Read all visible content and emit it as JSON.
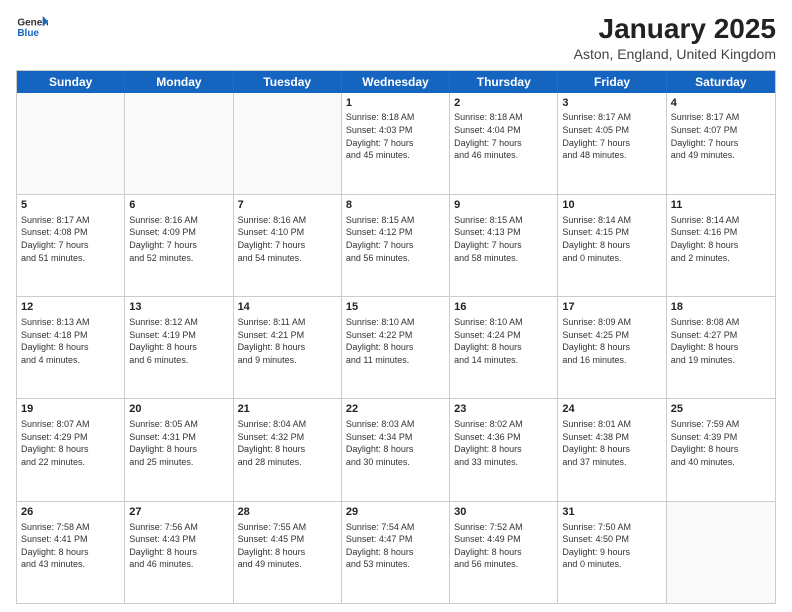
{
  "header": {
    "logo_general": "General",
    "logo_blue": "Blue",
    "title": "January 2025",
    "subtitle": "Aston, England, United Kingdom"
  },
  "weekdays": [
    "Sunday",
    "Monday",
    "Tuesday",
    "Wednesday",
    "Thursday",
    "Friday",
    "Saturday"
  ],
  "rows": [
    [
      {
        "day": "",
        "info": ""
      },
      {
        "day": "",
        "info": ""
      },
      {
        "day": "",
        "info": ""
      },
      {
        "day": "1",
        "info": "Sunrise: 8:18 AM\nSunset: 4:03 PM\nDaylight: 7 hours\nand 45 minutes."
      },
      {
        "day": "2",
        "info": "Sunrise: 8:18 AM\nSunset: 4:04 PM\nDaylight: 7 hours\nand 46 minutes."
      },
      {
        "day": "3",
        "info": "Sunrise: 8:17 AM\nSunset: 4:05 PM\nDaylight: 7 hours\nand 48 minutes."
      },
      {
        "day": "4",
        "info": "Sunrise: 8:17 AM\nSunset: 4:07 PM\nDaylight: 7 hours\nand 49 minutes."
      }
    ],
    [
      {
        "day": "5",
        "info": "Sunrise: 8:17 AM\nSunset: 4:08 PM\nDaylight: 7 hours\nand 51 minutes."
      },
      {
        "day": "6",
        "info": "Sunrise: 8:16 AM\nSunset: 4:09 PM\nDaylight: 7 hours\nand 52 minutes."
      },
      {
        "day": "7",
        "info": "Sunrise: 8:16 AM\nSunset: 4:10 PM\nDaylight: 7 hours\nand 54 minutes."
      },
      {
        "day": "8",
        "info": "Sunrise: 8:15 AM\nSunset: 4:12 PM\nDaylight: 7 hours\nand 56 minutes."
      },
      {
        "day": "9",
        "info": "Sunrise: 8:15 AM\nSunset: 4:13 PM\nDaylight: 7 hours\nand 58 minutes."
      },
      {
        "day": "10",
        "info": "Sunrise: 8:14 AM\nSunset: 4:15 PM\nDaylight: 8 hours\nand 0 minutes."
      },
      {
        "day": "11",
        "info": "Sunrise: 8:14 AM\nSunset: 4:16 PM\nDaylight: 8 hours\nand 2 minutes."
      }
    ],
    [
      {
        "day": "12",
        "info": "Sunrise: 8:13 AM\nSunset: 4:18 PM\nDaylight: 8 hours\nand 4 minutes."
      },
      {
        "day": "13",
        "info": "Sunrise: 8:12 AM\nSunset: 4:19 PM\nDaylight: 8 hours\nand 6 minutes."
      },
      {
        "day": "14",
        "info": "Sunrise: 8:11 AM\nSunset: 4:21 PM\nDaylight: 8 hours\nand 9 minutes."
      },
      {
        "day": "15",
        "info": "Sunrise: 8:10 AM\nSunset: 4:22 PM\nDaylight: 8 hours\nand 11 minutes."
      },
      {
        "day": "16",
        "info": "Sunrise: 8:10 AM\nSunset: 4:24 PM\nDaylight: 8 hours\nand 14 minutes."
      },
      {
        "day": "17",
        "info": "Sunrise: 8:09 AM\nSunset: 4:25 PM\nDaylight: 8 hours\nand 16 minutes."
      },
      {
        "day": "18",
        "info": "Sunrise: 8:08 AM\nSunset: 4:27 PM\nDaylight: 8 hours\nand 19 minutes."
      }
    ],
    [
      {
        "day": "19",
        "info": "Sunrise: 8:07 AM\nSunset: 4:29 PM\nDaylight: 8 hours\nand 22 minutes."
      },
      {
        "day": "20",
        "info": "Sunrise: 8:05 AM\nSunset: 4:31 PM\nDaylight: 8 hours\nand 25 minutes."
      },
      {
        "day": "21",
        "info": "Sunrise: 8:04 AM\nSunset: 4:32 PM\nDaylight: 8 hours\nand 28 minutes."
      },
      {
        "day": "22",
        "info": "Sunrise: 8:03 AM\nSunset: 4:34 PM\nDaylight: 8 hours\nand 30 minutes."
      },
      {
        "day": "23",
        "info": "Sunrise: 8:02 AM\nSunset: 4:36 PM\nDaylight: 8 hours\nand 33 minutes."
      },
      {
        "day": "24",
        "info": "Sunrise: 8:01 AM\nSunset: 4:38 PM\nDaylight: 8 hours\nand 37 minutes."
      },
      {
        "day": "25",
        "info": "Sunrise: 7:59 AM\nSunset: 4:39 PM\nDaylight: 8 hours\nand 40 minutes."
      }
    ],
    [
      {
        "day": "26",
        "info": "Sunrise: 7:58 AM\nSunset: 4:41 PM\nDaylight: 8 hours\nand 43 minutes."
      },
      {
        "day": "27",
        "info": "Sunrise: 7:56 AM\nSunset: 4:43 PM\nDaylight: 8 hours\nand 46 minutes."
      },
      {
        "day": "28",
        "info": "Sunrise: 7:55 AM\nSunset: 4:45 PM\nDaylight: 8 hours\nand 49 minutes."
      },
      {
        "day": "29",
        "info": "Sunrise: 7:54 AM\nSunset: 4:47 PM\nDaylight: 8 hours\nand 53 minutes."
      },
      {
        "day": "30",
        "info": "Sunrise: 7:52 AM\nSunset: 4:49 PM\nDaylight: 8 hours\nand 56 minutes."
      },
      {
        "day": "31",
        "info": "Sunrise: 7:50 AM\nSunset: 4:50 PM\nDaylight: 9 hours\nand 0 minutes."
      },
      {
        "day": "",
        "info": ""
      }
    ]
  ]
}
